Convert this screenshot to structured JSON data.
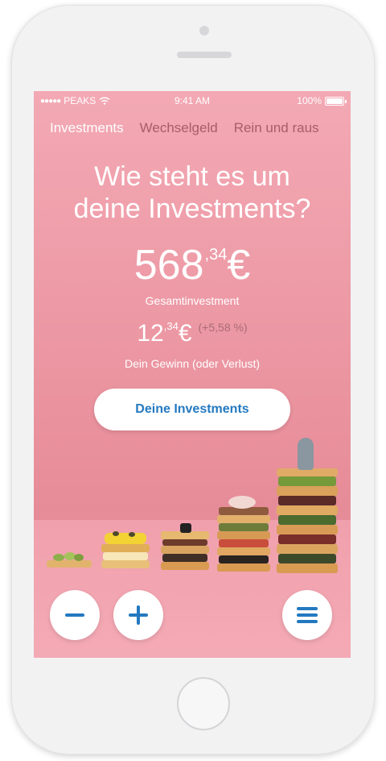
{
  "status_bar": {
    "carrier": "PEAKS",
    "signal": "●●●●●",
    "time": "9:41 AM",
    "battery": "100%"
  },
  "tabs": [
    {
      "label": "Investments",
      "active": true
    },
    {
      "label": "Wechselgeld",
      "active": false
    },
    {
      "label": "Rein und raus",
      "active": false
    }
  ],
  "headline_line1": "Wie steht es um",
  "headline_line2": "deine Investments?",
  "total": {
    "integer": "568",
    "decimals": ",34",
    "currency": "€",
    "label": "Gesamtinvestment"
  },
  "gain": {
    "integer": "12",
    "decimals": ",34",
    "currency": "€",
    "percent": "(+5,58 %)",
    "label": "Dein Gewinn (oder Verlust)"
  },
  "cta_label": "Deine Investments",
  "buttons": {
    "minus_icon": "minus-icon",
    "plus_icon": "plus-icon",
    "menu_icon": "menu-icon"
  },
  "colors": {
    "background": "#f3a9b4",
    "accent": "#2379c0",
    "tab_inactive": "#a85d68"
  }
}
